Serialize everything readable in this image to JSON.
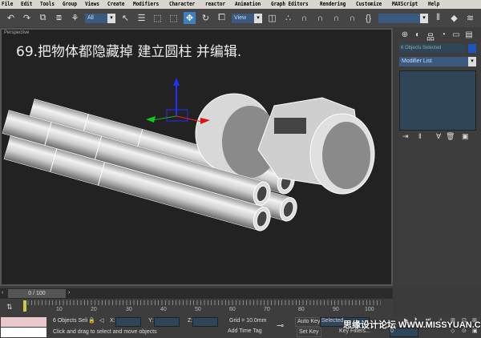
{
  "menu": [
    "File",
    "Edit",
    "Tools",
    "Group",
    "Views",
    "Create",
    "Modifiers",
    "Character",
    "reactor",
    "Animation",
    "Graph Editors",
    "Rendering",
    "Customize",
    "MAXScript",
    "Help"
  ],
  "toolbar": {
    "filter_value": "All",
    "refcoord_value": "View",
    "named_selection_value": ""
  },
  "viewport": {
    "label": "Perspective",
    "caption": "69.把物体都隐藏掉 建立圆柱 并编辑."
  },
  "panel": {
    "object_count": "6 Objects Selected",
    "modifier_list": "Modifier List",
    "color_swatch": "#1c55c0"
  },
  "timeline": {
    "position": "0 / 100",
    "frame": "0",
    "ticks": [
      "10",
      "20",
      "30",
      "40",
      "50",
      "60",
      "70",
      "80",
      "90",
      "100"
    ]
  },
  "status": {
    "selection": "6 Objects Seli",
    "x_label": "X:",
    "y_label": "Y:",
    "z_label": "Z:",
    "grid": "Grid = 10.0mm",
    "prompt": "Click and drag to select and move objects",
    "add_time_tag": "Add Time Tag",
    "auto_key": "Auto Key",
    "set_key": "Set Key",
    "key_mode": "Selected",
    "key_filters": "Key Filters...",
    "current_frame": "0"
  },
  "watermark": "思缘设计论坛 WWW.MISSYUAN.COM"
}
